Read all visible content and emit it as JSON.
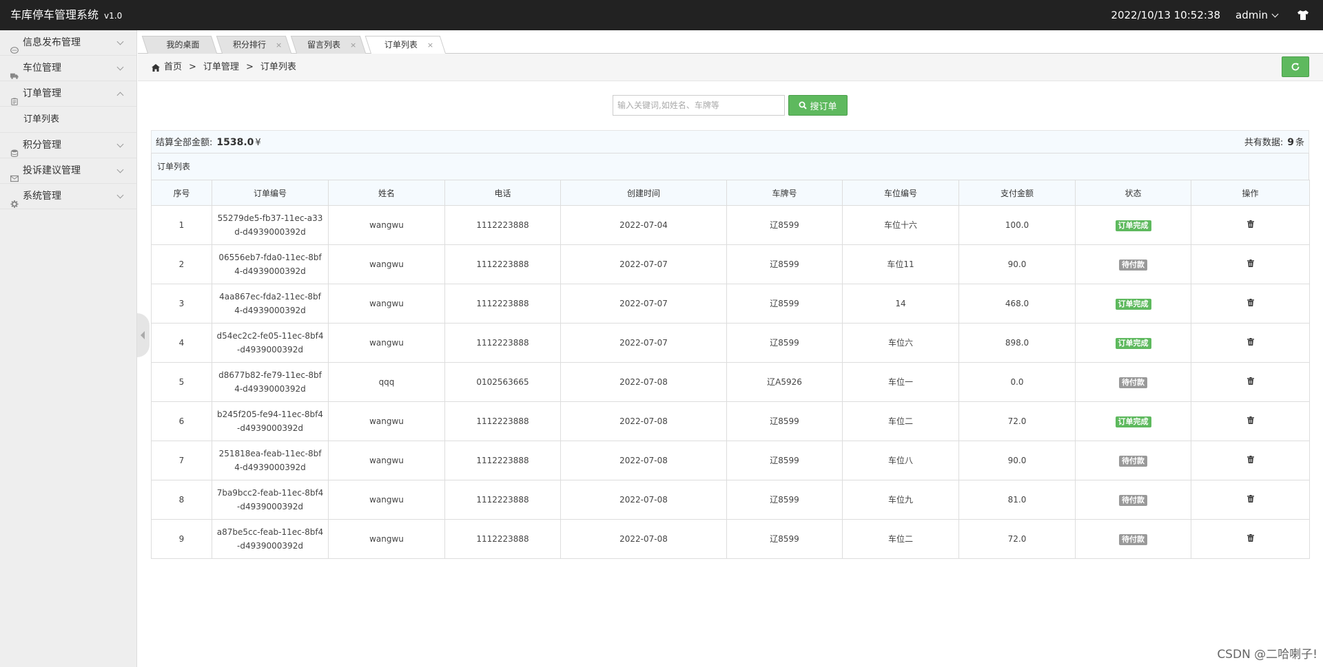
{
  "header": {
    "title": "车库停车管理系统",
    "version": "v1.0",
    "datetime": "2022/10/13 10:52:38",
    "user": "admin"
  },
  "sidebar": {
    "items": [
      {
        "label": "信息发布管理",
        "icon": "comment-icon",
        "expanded": false
      },
      {
        "label": "车位管理",
        "icon": "truck-icon",
        "expanded": false
      },
      {
        "label": "订单管理",
        "icon": "clipboard-icon",
        "expanded": true,
        "children": [
          "订单列表"
        ]
      },
      {
        "label": "积分管理",
        "icon": "database-icon",
        "expanded": false
      },
      {
        "label": "投诉建议管理",
        "icon": "envelope-icon",
        "expanded": false
      },
      {
        "label": "系统管理",
        "icon": "gear-icon",
        "expanded": false
      }
    ]
  },
  "tabs": [
    {
      "label": "我的桌面",
      "closable": false
    },
    {
      "label": "积分排行",
      "closable": true
    },
    {
      "label": "留言列表",
      "closable": true
    },
    {
      "label": "订单列表",
      "closable": true,
      "active": true
    }
  ],
  "breadcrumb": [
    "首页",
    "订单管理",
    "订单列表"
  ],
  "breadcrumb_sep": ">",
  "search": {
    "placeholder": "输入关键词,如姓名、车牌等",
    "button_label": "搜订单"
  },
  "summary": {
    "total_label": "结算全部金额:",
    "total_value": "1538.0",
    "currency": "¥",
    "count_label": "共有数据:",
    "count_value": "9",
    "count_unit": "条"
  },
  "table": {
    "caption": "订单列表",
    "columns": [
      "序号",
      "订单编号",
      "姓名",
      "电话",
      "创建时间",
      "车牌号",
      "车位编号",
      "支付金额",
      "状态",
      "操作"
    ],
    "rows": [
      [
        "1",
        "55279de5-fb37-11ec-a33d-d4939000392d",
        "wangwu",
        "1112223888",
        "2022-07-04",
        "辽8599",
        "车位十六",
        "100.0",
        "订单完成"
      ],
      [
        "2",
        "06556eb7-fda0-11ec-8bf4-d4939000392d",
        "wangwu",
        "1112223888",
        "2022-07-07",
        "辽8599",
        "车位11",
        "90.0",
        "待付款"
      ],
      [
        "3",
        "4aa867ec-fda2-11ec-8bf4-d4939000392d",
        "wangwu",
        "1112223888",
        "2022-07-07",
        "辽8599",
        "14",
        "468.0",
        "订单完成"
      ],
      [
        "4",
        "d54ec2c2-fe05-11ec-8bf4-d4939000392d",
        "wangwu",
        "1112223888",
        "2022-07-07",
        "辽8599",
        "车位六",
        "898.0",
        "订单完成"
      ],
      [
        "5",
        "d8677b82-fe79-11ec-8bf4-d4939000392d",
        "qqq",
        "0102563665",
        "2022-07-08",
        "辽A5926",
        "车位一",
        "0.0",
        "待付款"
      ],
      [
        "6",
        "b245f205-fe94-11ec-8bf4-d4939000392d",
        "wangwu",
        "1112223888",
        "2022-07-08",
        "辽8599",
        "车位二",
        "72.0",
        "订单完成"
      ],
      [
        "7",
        "251818ea-feab-11ec-8bf4-d4939000392d",
        "wangwu",
        "1112223888",
        "2022-07-08",
        "辽8599",
        "车位八",
        "90.0",
        "待付款"
      ],
      [
        "8",
        "7ba9bcc2-feab-11ec-8bf4-d4939000392d",
        "wangwu",
        "1112223888",
        "2022-07-08",
        "辽8599",
        "车位九",
        "81.0",
        "待付款"
      ],
      [
        "9",
        "a87be5cc-feab-11ec-8bf4-d4939000392d",
        "wangwu",
        "1112223888",
        "2022-07-08",
        "辽8599",
        "车位二",
        "72.0",
        "待付款"
      ]
    ]
  },
  "status_colors": {
    "订单完成": "#5eb95e",
    "待付款": "#999999"
  },
  "accent_color": "#5eb95e",
  "watermark": "CSDN @二哈喇子!"
}
